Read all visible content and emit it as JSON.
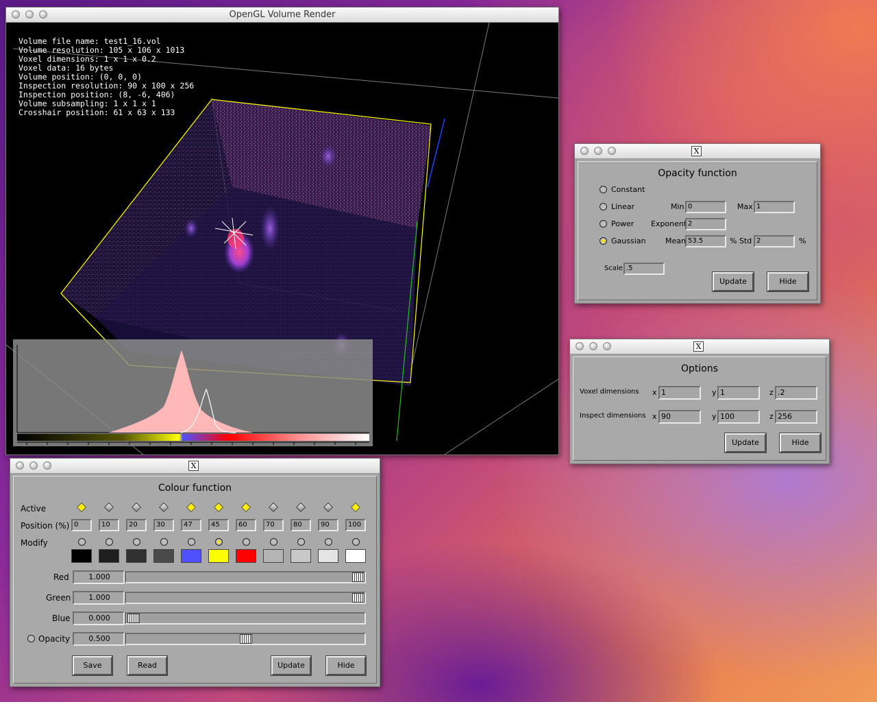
{
  "render_window": {
    "title": "OpenGL Volume Render",
    "info_lines": [
      "Volume file name: test1_16.vol",
      "Volume resolution: 105 x 106 x 1013",
      "Voxel dimensions: 1 x 1 x 0.2",
      "Voxel data: 16 bytes",
      "Volume position: (0, 0, 0)",
      "Inspection resolution: 90 x 100 x 256",
      "Inspection position: (8, -6, 406)",
      "Volume subsampling: 1 x 1 x 1",
      "Crosshair position: 61 x 63 x 133"
    ]
  },
  "opacity": {
    "title_icon": "X",
    "heading": "Opacity function",
    "options": [
      "Constant",
      "Linear",
      "Power",
      "Gaussian"
    ],
    "selected": "Gaussian",
    "min_label": "Min",
    "min": "0",
    "max_label": "Max",
    "max": "1",
    "exponent_label": "Exponent",
    "exponent": "2",
    "mean_label": "Mean",
    "mean": "53.5",
    "std_label": "Std",
    "std": "2",
    "percent": "%",
    "scale_label": "Scale",
    "scale": ".5",
    "update": "Update",
    "hide": "Hide"
  },
  "options": {
    "title_icon": "X",
    "heading": "Options",
    "voxel_label": "Voxel dimensions",
    "inspect_label": "Inspect dimensions",
    "x_label": "x",
    "y_label": "y",
    "z_label": "z",
    "voxel": {
      "x": "1",
      "y": "1",
      "z": ".2"
    },
    "inspect": {
      "x": "90",
      "y": "100",
      "z": "256"
    },
    "update": "Update",
    "hide": "Hide"
  },
  "colour": {
    "title_icon": "X",
    "heading": "Colour function",
    "active_label": "Active",
    "position_label": "Position (%)",
    "modify_label": "Modify",
    "active": [
      true,
      false,
      false,
      false,
      true,
      true,
      true,
      false,
      false,
      false,
      true
    ],
    "positions": [
      "0",
      "10",
      "20",
      "30",
      "47",
      "45",
      "60",
      "70",
      "80",
      "90",
      "100"
    ],
    "modify_selected": 5,
    "swatches": [
      "#000000",
      "#1e1e1e",
      "#303030",
      "#4a4a4a",
      "#5050ff",
      "#ffff00",
      "#ff0000",
      "#b4b4b4",
      "#c8c8c8",
      "#e4e4e4",
      "#ffffff"
    ],
    "red_label": "Red",
    "red": "1.000",
    "red_level": 1.0,
    "green_label": "Green",
    "green": "1.000",
    "green_level": 1.0,
    "blue_label": "Blue",
    "blue": "0.000",
    "blue_level": 0.0,
    "opacity_label": "Opacity",
    "opacity": "0.500",
    "opacity_level": 0.5,
    "save": "Save",
    "read": "Read",
    "update": "Update",
    "hide": "Hide"
  }
}
